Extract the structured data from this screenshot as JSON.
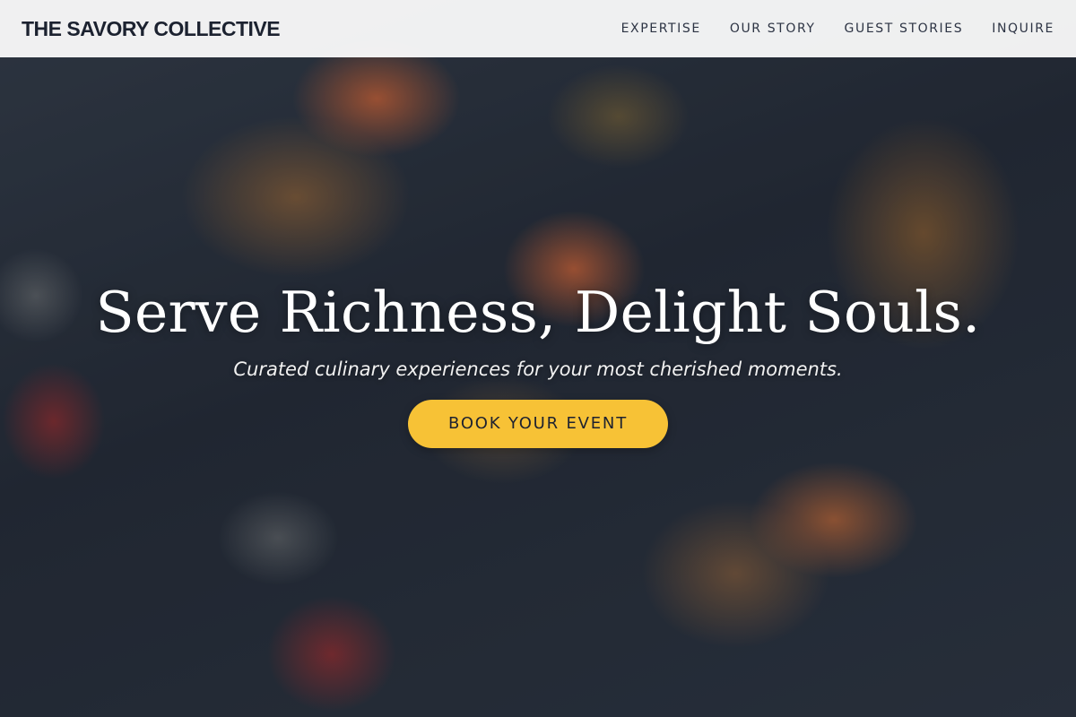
{
  "header": {
    "brand": "THE SAVORY COLLECTIVE",
    "nav": [
      {
        "label": "EXPERTISE"
      },
      {
        "label": "OUR STORY"
      },
      {
        "label": "GUEST STORIES"
      },
      {
        "label": "INQUIRE"
      }
    ]
  },
  "hero": {
    "headline": "Serve Richness, Delight Souls.",
    "subheadline": "Curated culinary experiences for your most cherished moments.",
    "cta_label": "BOOK YOUR EVENT",
    "background_image": "canapes-on-slate-photo"
  },
  "colors": {
    "accent": "#f7c236",
    "text_dark": "#1c2230",
    "nav_bg": "#ffffff"
  }
}
